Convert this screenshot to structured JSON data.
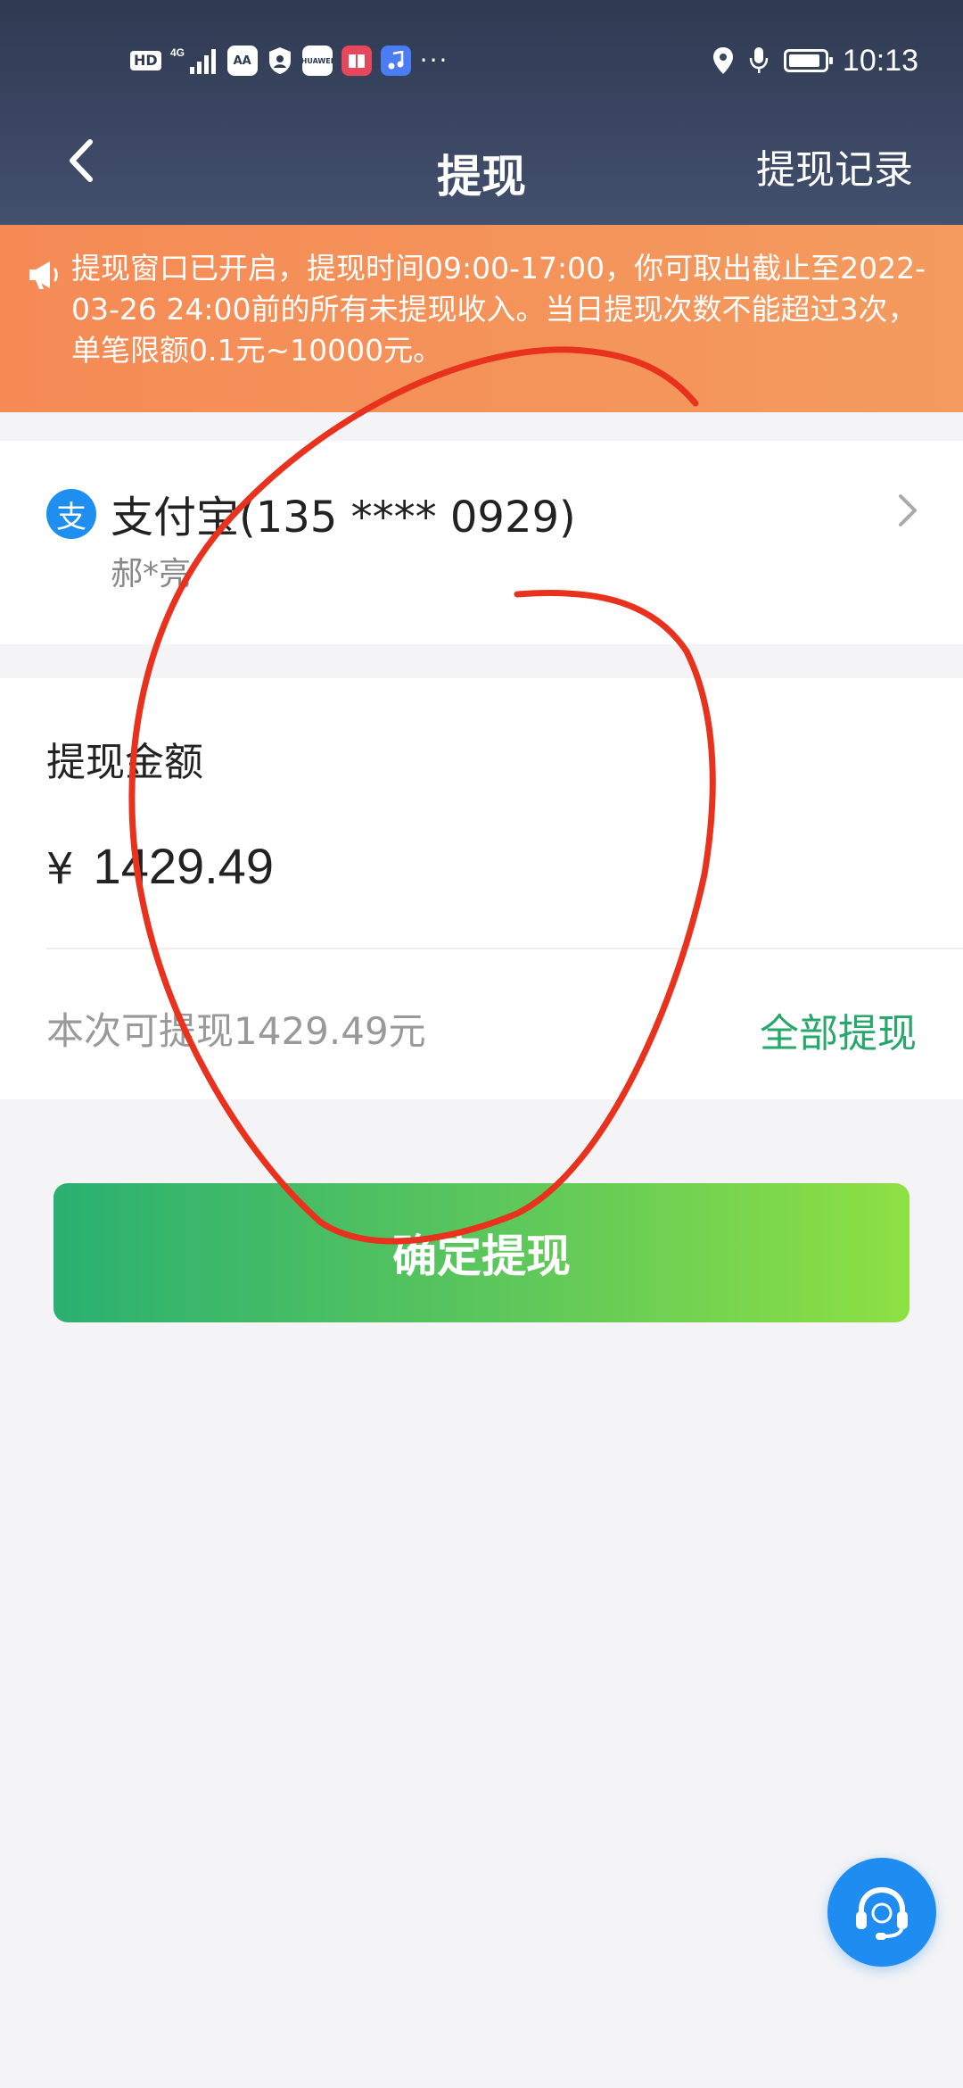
{
  "status_bar": {
    "network_label": "4G",
    "hd_label": "HD",
    "app_icons": [
      "AA",
      "HUAWEI"
    ],
    "time": "10:13"
  },
  "nav": {
    "title": "提现",
    "records_label": "提现记录"
  },
  "notice": {
    "icon": "megaphone-icon",
    "text": "提现窗口已开启，提现时间09:00-17:00，你可取出截止至2022-03-26 24:00前的所有未提现收入。当日提现次数不能超过3次，单笔限额0.1元~10000元。"
  },
  "account": {
    "logo_char": "支",
    "title": "支付宝(135 **** 0929)",
    "name": "郝*亮"
  },
  "amount": {
    "label": "提现金额",
    "currency": "¥",
    "value": "1429.49",
    "available_text": "本次可提现1429.49元",
    "withdraw_all_label": "全部提现"
  },
  "confirm_label": "确定提现",
  "colors": {
    "header": "#2f3a52",
    "notice": "#f58a55",
    "accent_green": "#26a86a",
    "alipay_blue": "#1e8ff0",
    "annotation_red": "#e8321e"
  }
}
